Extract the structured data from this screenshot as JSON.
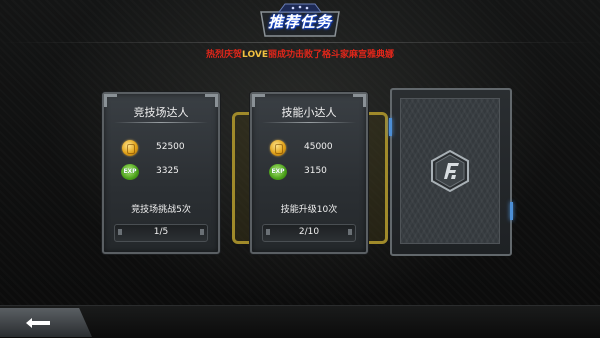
{
  "header": {
    "title": "推荐任务",
    "marquee_prefix": "热烈庆贺",
    "marquee_highlight": "LOVE",
    "marquee_suffix": "丽成功击败了格斗家麻宫雅典娜"
  },
  "cards": [
    {
      "title": "竞技场达人",
      "gold": "52500",
      "exp": "3325",
      "description": "竞技场挑战5次",
      "progress": "1/5"
    },
    {
      "title": "技能小达人",
      "gold": "45000",
      "exp": "3150",
      "description": "技能升级10次",
      "progress": "2/10"
    }
  ],
  "icons": {
    "exp_label": "EXP"
  },
  "colors": {
    "marquee_red": "#e0261a",
    "title_blue": "#1a4bd6",
    "gold": "#e1a21a",
    "exp_green": "#4aa01a"
  }
}
